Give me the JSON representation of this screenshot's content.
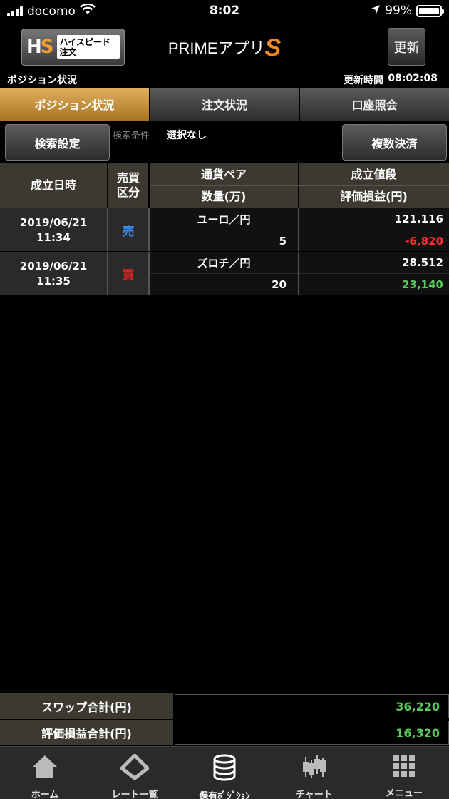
{
  "status_bar": {
    "carrier": "docomo",
    "time": "8:02",
    "battery": "99%"
  },
  "header": {
    "hs_logo": "HS",
    "hs_label": "ハイスピード注文",
    "app_title_main": "PRIMEアプリ",
    "app_title_accent": "S",
    "refresh_label": "更新"
  },
  "info_bar": {
    "page_title": "ポジション状況",
    "update_label": "更新時間",
    "update_time": "08:02:08"
  },
  "tabs": [
    {
      "label": "ポジション状況",
      "active": true
    },
    {
      "label": "注文状況",
      "active": false
    },
    {
      "label": "口座照会",
      "active": false
    }
  ],
  "search": {
    "settings_button": "検索設定",
    "condition_label": "検索条件",
    "condition_value": "選択なし",
    "multi_settle_button": "複数決済"
  },
  "table": {
    "headers": {
      "date": "成立日時",
      "side": "売買\n区分",
      "pair": "通貨ペア",
      "quantity": "数量(万)",
      "price": "成立値段",
      "pl": "評価損益(円)"
    },
    "rows": [
      {
        "date": "2019/06/21\n11:34",
        "side": "売",
        "side_color": "#3b8cf0",
        "pair": "ユーロ／円",
        "quantity": "5",
        "price": "121.116",
        "pl": "-6,820",
        "pl_color": "#ff3030"
      },
      {
        "date": "2019/06/21\n11:35",
        "side": "買",
        "side_color": "#e02020",
        "pair": "ズロチ／円",
        "quantity": "20",
        "price": "28.512",
        "pl": "23,140",
        "pl_color": "#5ac85a"
      }
    ]
  },
  "totals": {
    "swap_label": "スワップ合計(円)",
    "swap_value": "36,220",
    "pl_label": "評価損益合計(円)",
    "pl_value": "16,320",
    "value_color": "#5ac85a"
  },
  "bottom_nav": [
    {
      "label": "ホーム",
      "icon": "home-icon",
      "active": false
    },
    {
      "label": "レート一覧",
      "icon": "rate-list-icon",
      "active": false
    },
    {
      "label": "保有ﾎﾟｼﾞｼｮﾝ",
      "icon": "positions-icon",
      "active": true
    },
    {
      "label": "チャート",
      "icon": "chart-icon",
      "active": false
    },
    {
      "label": "メニュー",
      "icon": "menu-grid-icon",
      "active": false
    }
  ]
}
